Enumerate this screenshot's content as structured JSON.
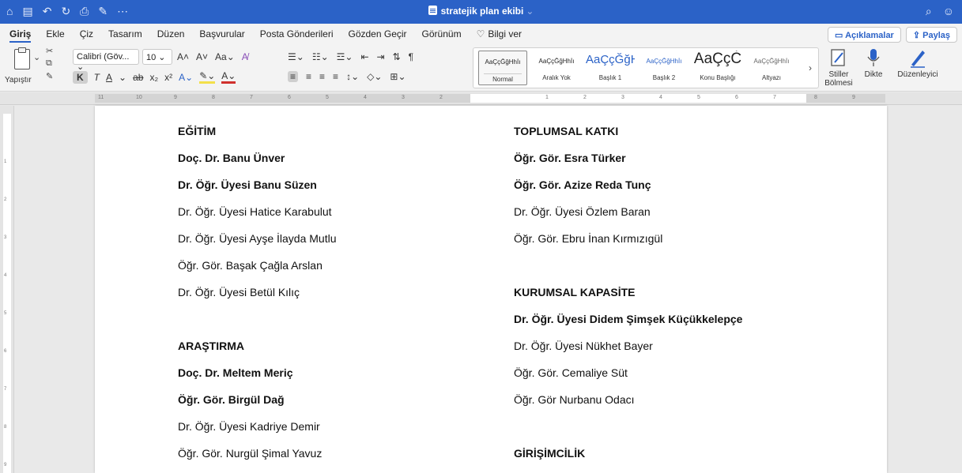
{
  "window": {
    "title": "stratejik plan ekibi"
  },
  "menu": {
    "tabs": [
      "Giriş",
      "Ekle",
      "Çiz",
      "Tasarım",
      "Düzen",
      "Başvurular",
      "Posta Gönderileri",
      "Gözden Geçir",
      "Görünüm"
    ],
    "help": "Bilgi ver",
    "comments_label": "Açıklamalar",
    "share_label": "Paylaş"
  },
  "ribbon": {
    "paste_label": "Yapıştır",
    "font_name": "Calibri (Göv...",
    "font_size": "10",
    "styles": [
      {
        "preview": "AaÇçĞğHhİı",
        "name": "Normal"
      },
      {
        "preview": "AaÇçĞğHhİı",
        "name": "Aralık Yok"
      },
      {
        "preview": "AaÇçĞğHİ",
        "name": "Başlık 1"
      },
      {
        "preview": "AaÇçĞğHhİı",
        "name": "Başlık 2"
      },
      {
        "preview": "AaÇçĊ",
        "name": "Konu Başlığı"
      },
      {
        "preview": "AaÇçĞğHhİı",
        "name": "Altyazı"
      }
    ],
    "styles_pane_label": "Stiller Bölmesi",
    "dictate_label": "Dikte",
    "editor_label": "Düzenleyici"
  },
  "document": {
    "left_column": [
      {
        "text": "EĞİTİM",
        "bold": true
      },
      {
        "text": "Doç. Dr. Banu Ünver",
        "bold": true
      },
      {
        "text": "Dr. Öğr. Üyesi Banu Süzen",
        "bold": true
      },
      {
        "text": "Dr. Öğr. Üyesi Hatice Karabulut",
        "bold": false
      },
      {
        "text": "Dr. Öğr. Üyesi Ayşe İlayda Mutlu",
        "bold": false
      },
      {
        "text": "Öğr. Gör. Başak Çağla Arslan",
        "bold": false
      },
      {
        "text": "Dr. Öğr. Üyesi Betül Kılıç",
        "bold": false
      },
      {
        "text": "ARAŞTIRMA",
        "bold": true
      },
      {
        "text": "Doç. Dr. Meltem Meriç",
        "bold": true
      },
      {
        "text": "Öğr. Gör. Birgül Dağ",
        "bold": true
      },
      {
        "text": "Dr. Öğr. Üyesi Kadriye Demir",
        "bold": false
      },
      {
        "text": "Öğr. Gör. Nurgül Şimal Yavuz",
        "bold": false
      }
    ],
    "right_column": [
      {
        "text": "TOPLUMSAL KATKI",
        "bold": true
      },
      {
        "text": "Öğr. Gör. Esra Türker",
        "bold": true
      },
      {
        "text": "Öğr. Gör. Azize Reda Tunç",
        "bold": true
      },
      {
        "text": "Dr. Öğr. Üyesi Özlem Baran",
        "bold": false
      },
      {
        "text": "Öğr. Gör. Ebru İnan Kırmızıgül",
        "bold": false
      },
      {
        "text": "KURUMSAL KAPASİTE",
        "bold": true
      },
      {
        "text": "Dr. Öğr. Üyesi Didem Şimşek Küçükkelepçe",
        "bold": true
      },
      {
        "text": "Dr. Öğr. Üyesi Nükhet Bayer",
        "bold": false
      },
      {
        "text": "Öğr. Gör. Cemaliye Süt",
        "bold": false
      },
      {
        "text": "Öğr. Gör Nurbanu Odacı",
        "bold": false
      },
      {
        "text": "GİRİŞİMCİLİK",
        "bold": true
      }
    ]
  },
  "colors": {
    "title_bar": "#2b62c7",
    "ribbon_bg": "#f3f3f3",
    "page_bg": "#ffffff",
    "spell_underline": "#d0312d"
  }
}
